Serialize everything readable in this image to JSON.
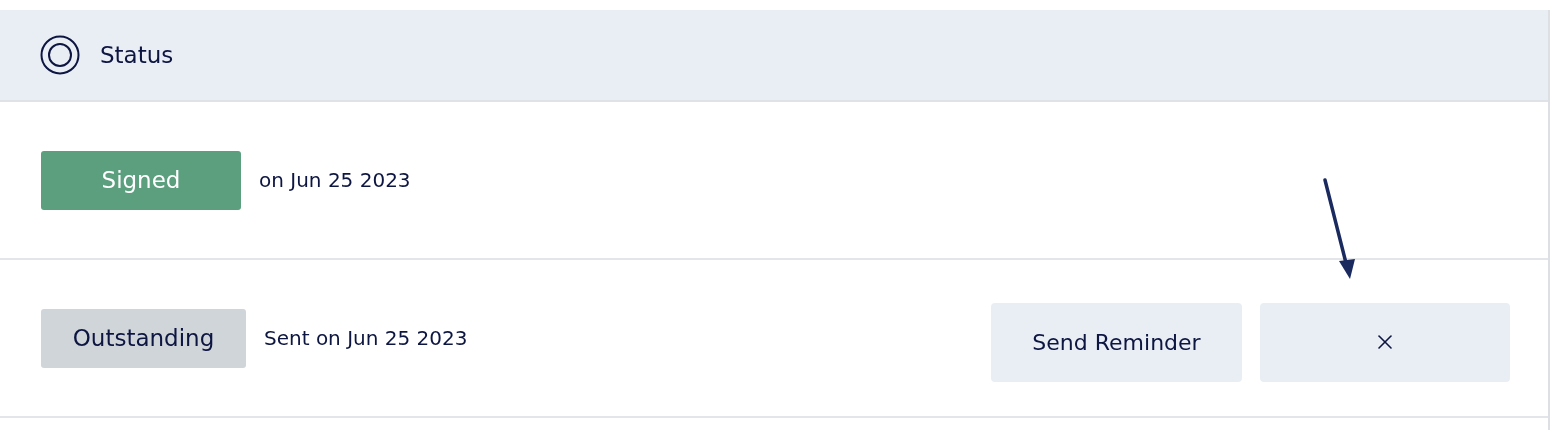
{
  "header": {
    "title": "Status"
  },
  "rows": [
    {
      "kind": "signed",
      "badge": "Signed",
      "text": "on Jun 25 2023",
      "actions": []
    },
    {
      "kind": "outstanding",
      "badge": "Outstanding",
      "text": "Sent on Jun 25 2023",
      "actions": [
        {
          "kind": "text",
          "label": "Send Reminder"
        },
        {
          "kind": "close"
        }
      ]
    }
  ],
  "annotation": {
    "kind": "arrow"
  }
}
